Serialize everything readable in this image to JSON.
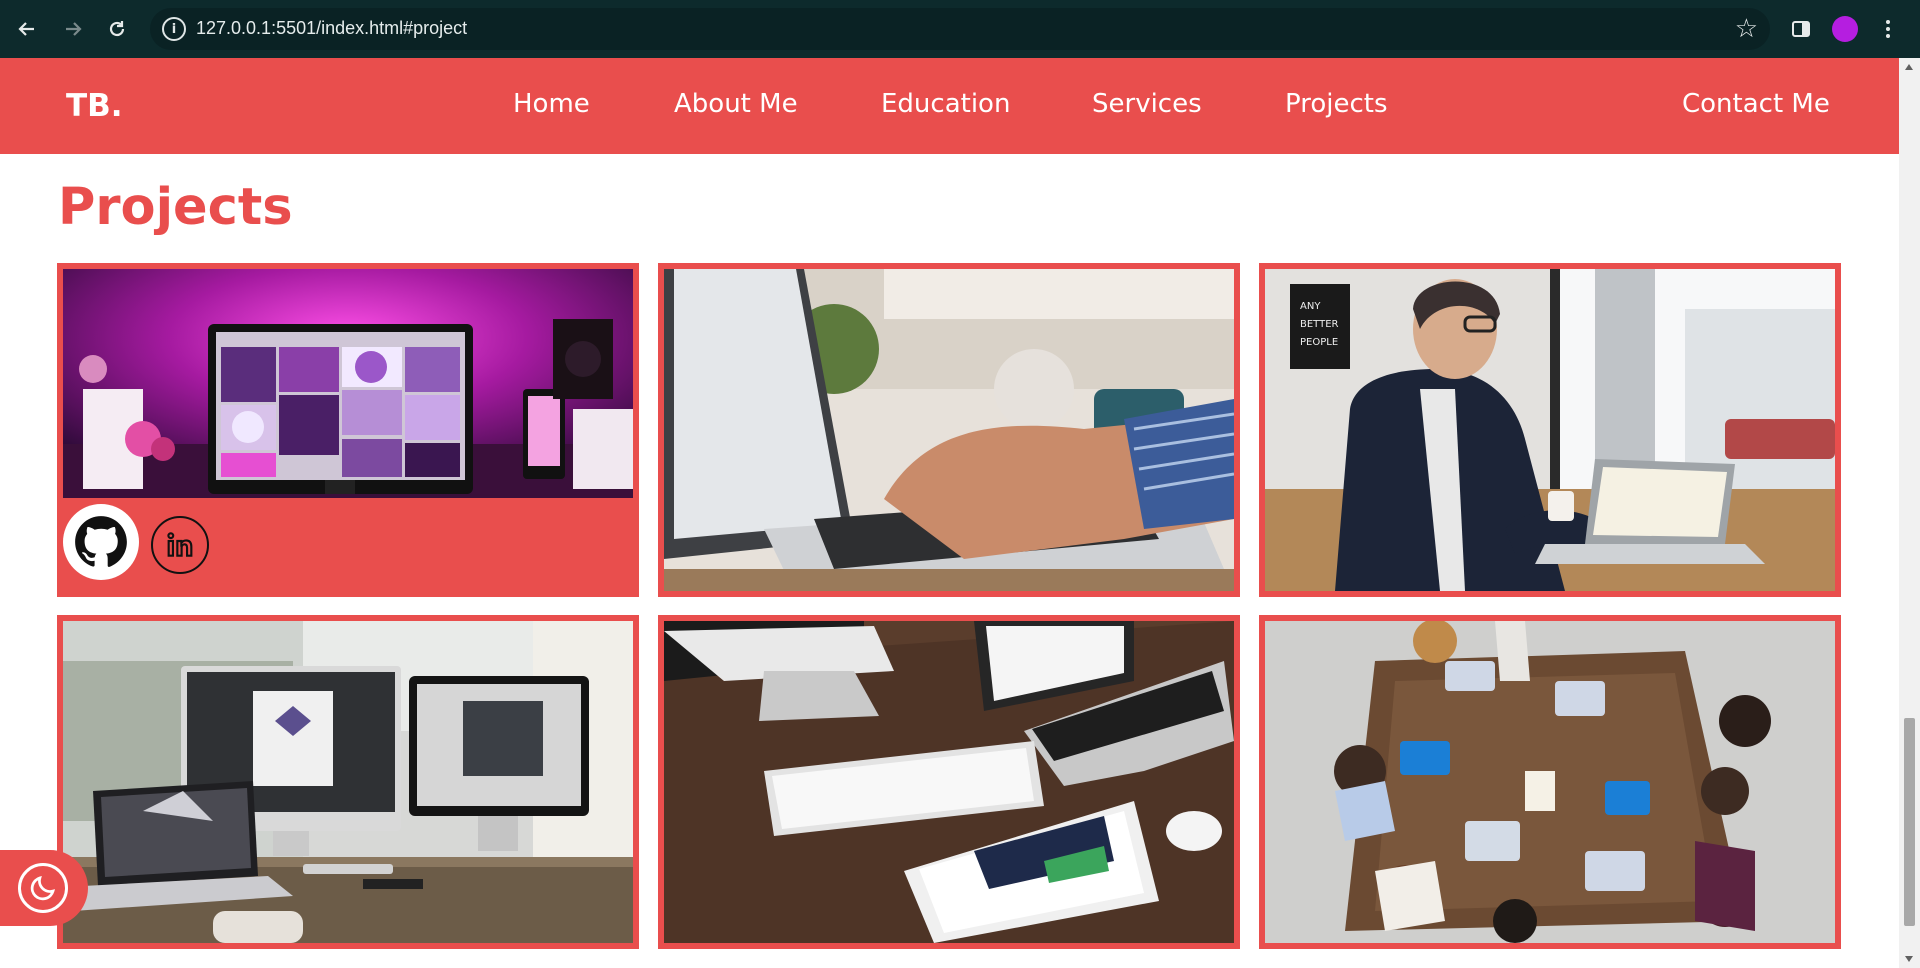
{
  "browser": {
    "url": "127.0.0.1:5501/index.html#project",
    "icons": [
      "back-arrow-icon",
      "forward-arrow-icon",
      "reload-icon",
      "site-info-icon",
      "bookmark-star-icon",
      "side-panel-icon",
      "profile-avatar",
      "kebab-menu-icon"
    ]
  },
  "site": {
    "logo": "TB.",
    "nav": {
      "home": "Home",
      "about": "About Me",
      "education": "Education",
      "services": "Services",
      "projects": "Projects",
      "contact": "Contact Me"
    }
  },
  "projects": {
    "title": "Projects",
    "cards": [
      {
        "image": "desk-pink-monitor-photo",
        "social": [
          "github-icon",
          "linkedin-icon"
        ]
      },
      {
        "image": "laptop-typing-photo"
      },
      {
        "image": "man-laptop-cafe-photo"
      },
      {
        "image": "dual-monitor-workspace-photo"
      },
      {
        "image": "apple-devices-desk-photo"
      },
      {
        "image": "team-meeting-table-photo"
      }
    ]
  },
  "theme_toggle": {
    "icon": "moon-icon"
  },
  "colors": {
    "accent": "#e94e4d",
    "chrome": "#0d2a2c",
    "white": "#ffffff"
  }
}
